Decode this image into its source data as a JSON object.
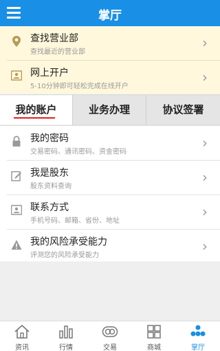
{
  "header": {
    "title": "掌厅",
    "menu_icon": "hamburger-menu-icon",
    "background": "#1a8fe6"
  },
  "top_panel": {
    "items": [
      {
        "title": "查找营业部",
        "subtitle": "查找最近的营业部",
        "icon": "location-pin-icon"
      },
      {
        "title": "网上开户",
        "subtitle": "5-10分钟即可轻松完成在线开户",
        "icon": "id-card-icon"
      }
    ]
  },
  "tabs": [
    {
      "label": "我的账户",
      "active": true
    },
    {
      "label": "业务办理",
      "active": false
    },
    {
      "label": "协议签署",
      "active": false
    }
  ],
  "account_list": [
    {
      "title": "我的密码",
      "subtitle": "交易密码、通讯密码、资金密码",
      "icon": "lock-icon"
    },
    {
      "title": "我是股东",
      "subtitle": "股东资料查询",
      "icon": "edit-icon"
    },
    {
      "title": "联系方式",
      "subtitle": "手机号码、邮箱、省份、地址",
      "icon": "contact-card-icon"
    },
    {
      "title": "我的风险承受能力",
      "subtitle": "评测您的风险承受能力",
      "icon": "warning-icon"
    }
  ],
  "bottom_nav": [
    {
      "label": "资讯",
      "icon": "home-icon",
      "active": false
    },
    {
      "label": "行情",
      "icon": "bar-chart-icon",
      "active": false
    },
    {
      "label": "交易",
      "icon": "exchange-icon",
      "active": false
    },
    {
      "label": "商城",
      "icon": "grid-icon",
      "active": false
    },
    {
      "label": "掌厅",
      "icon": "people-icon",
      "active": true
    }
  ],
  "colors": {
    "accent": "#1a8fe6",
    "tab_active_underline": "#e02020",
    "top_panel_bg": "#fff8dc"
  }
}
